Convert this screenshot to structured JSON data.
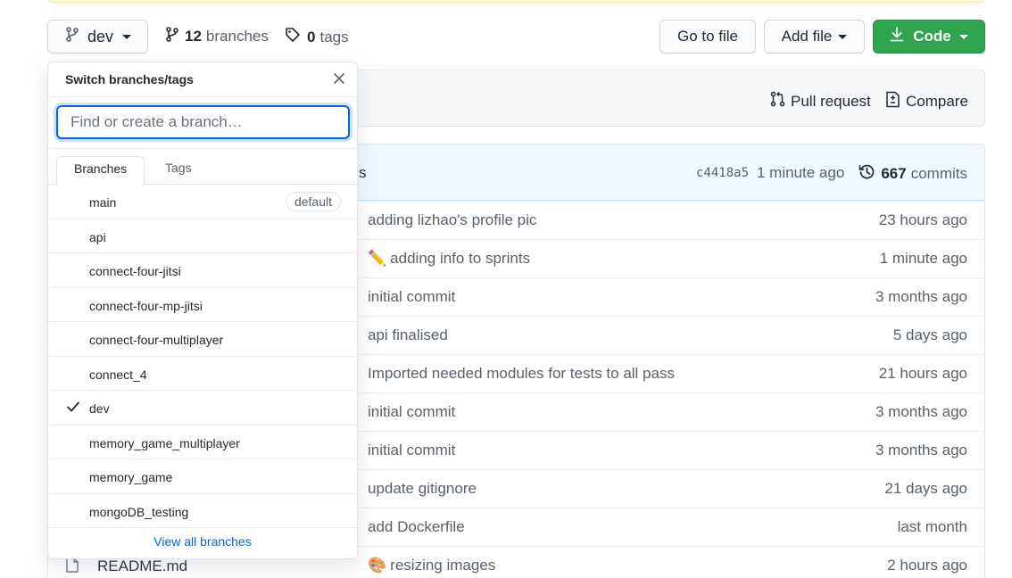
{
  "toolbar": {
    "branch_label": "dev",
    "branches_count": "12",
    "branches_word": "branches",
    "tags_count": "0",
    "tags_word": "tags",
    "goto_file": "Go to file",
    "add_file": "Add file",
    "code": "Code"
  },
  "compare_bar": {
    "pull_request": "Pull request",
    "compare": "Compare"
  },
  "latest_commit": {
    "message_fragment": "s",
    "sha": "c4418a5",
    "time": "1 minute ago",
    "commits_count": "667",
    "commits_word": "commits"
  },
  "files": [
    {
      "name": "",
      "message": "adding lizhao's profile pic",
      "emoji": "",
      "time": "23 hours ago"
    },
    {
      "name": "",
      "message": "adding info to sprints",
      "emoji": "✏️",
      "time": "1 minute ago"
    },
    {
      "name": "",
      "message": "initial commit",
      "emoji": "",
      "time": "3 months ago"
    },
    {
      "name": "",
      "message": "api finalised",
      "emoji": "",
      "time": "5 days ago"
    },
    {
      "name": "",
      "message": "Imported needed modules for tests to all pass",
      "emoji": "",
      "time": "21 hours ago"
    },
    {
      "name": "",
      "message": "initial commit",
      "emoji": "",
      "time": "3 months ago"
    },
    {
      "name": "",
      "message": "initial commit",
      "emoji": "",
      "time": "3 months ago"
    },
    {
      "name": "",
      "message": "update gitignore",
      "emoji": "",
      "time": "21 days ago"
    },
    {
      "name": "",
      "message": "add Dockerfile",
      "emoji": "",
      "time": "last month"
    },
    {
      "name": "README.md",
      "message": "resizing images",
      "emoji": "🎨",
      "time": "2 hours ago"
    }
  ],
  "dropdown": {
    "title": "Switch branches/tags",
    "filter_placeholder": "Find or create a branch…",
    "tabs": [
      "Branches",
      "Tags"
    ],
    "branches": [
      {
        "name": "main",
        "badge": "default",
        "selected": false
      },
      {
        "name": "api",
        "badge": "",
        "selected": false
      },
      {
        "name": "connect-four-jitsi",
        "badge": "",
        "selected": false
      },
      {
        "name": "connect-four-mp-jitsi",
        "badge": "",
        "selected": false
      },
      {
        "name": "connect-four-multiplayer",
        "badge": "",
        "selected": false
      },
      {
        "name": "connect_4",
        "badge": "",
        "selected": false
      },
      {
        "name": "dev",
        "badge": "",
        "selected": true
      },
      {
        "name": "memory_game_multiplayer",
        "badge": "",
        "selected": false
      },
      {
        "name": "memory_game",
        "badge": "",
        "selected": false
      },
      {
        "name": "mongoDB_testing",
        "badge": "",
        "selected": false
      }
    ],
    "view_all": "View all branches"
  },
  "colors": {
    "primary_green": "#2ea44f",
    "link_blue": "#0366d6",
    "commit_header_bg": "#f1f8ff"
  }
}
